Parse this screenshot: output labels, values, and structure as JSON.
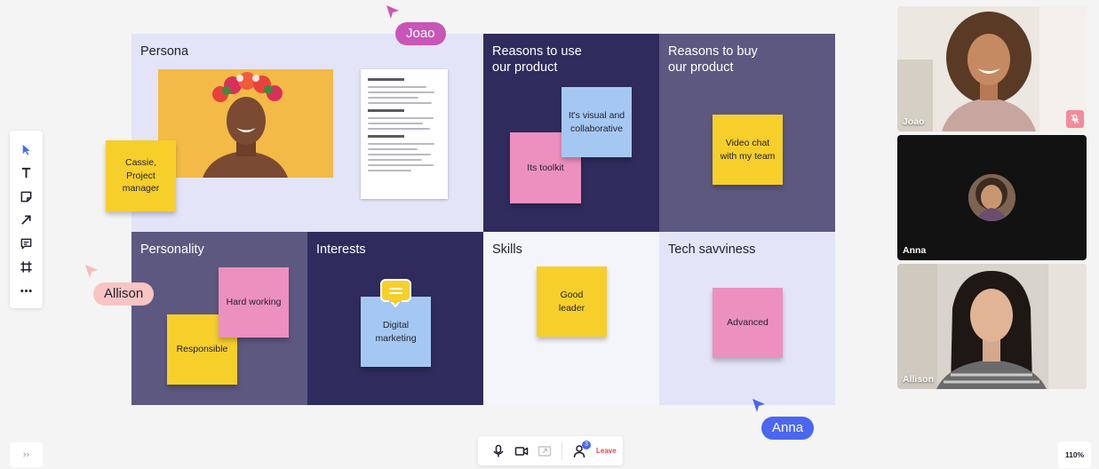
{
  "board": {
    "cells": {
      "persona": "Persona",
      "reasons_use": "Reasons to use\nour product",
      "reasons_buy": "Reasons to buy\nour product",
      "personality": "Personality",
      "interests": "Interests",
      "skills": "Skills",
      "tech": "Tech savviness"
    },
    "stickies": {
      "persona_name": "Cassie,\nProject\nmanager",
      "visual": "It's visual and\ncollaborative",
      "toolkit": "Its toolkit",
      "video_chat": "Video chat\nwith my team",
      "hard_working": "Hard working",
      "responsible": "Responsible",
      "digital_marketing": "Digital\nmarketing",
      "good_leader": "Good\nleader",
      "advanced": "Advanced"
    }
  },
  "toolbar": {
    "tools": [
      "select-icon",
      "text-icon",
      "sticky-note-icon",
      "arrow-icon",
      "comment-icon",
      "frame-icon",
      "more-icon"
    ]
  },
  "cursors": {
    "joao": {
      "name": "Joao",
      "color": "#c855b8"
    },
    "allison": {
      "name": "Allison",
      "color": "#f8c4c4"
    },
    "anna": {
      "name": "Anna",
      "color": "#4a67ee"
    }
  },
  "videos": [
    {
      "name": "Joao",
      "muted": true
    },
    {
      "name": "Anna",
      "muted": false
    },
    {
      "name": "Allison",
      "muted": false
    }
  ],
  "bottom_bar": {
    "participants_count": "3",
    "leave_label": "Leave"
  },
  "zoom_level": "110%",
  "expand_label": "››",
  "colors": {
    "accent": "#4a67ee",
    "leave": "#e5484d",
    "sticky_yellow": "#f6cf2a",
    "sticky_pink": "#ec90bf",
    "sticky_blue": "#a5c8f2"
  }
}
